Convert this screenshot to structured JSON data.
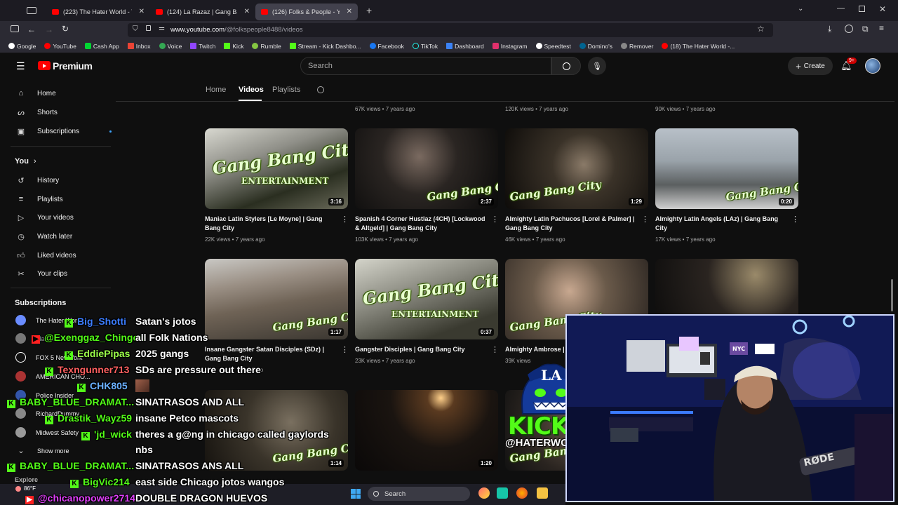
{
  "browser": {
    "tabs": [
      {
        "title": "(223) The Hater World - YouTube"
      },
      {
        "title": "(124) La Razaz | Gang Bang City"
      },
      {
        "title": "(126) Folks & People - YouTube"
      }
    ],
    "new_tab": "+",
    "url_domain": "www.youtube.com",
    "url_path": "/@folkspeople8488/videos",
    "bookmarks": [
      "Google",
      "YouTube",
      "Cash App",
      "Inbox",
      "Voice",
      "Twitch",
      "Kick",
      "Rumble",
      "Stream - Kick Dashbo...",
      "Facebook",
      "TikTok",
      "Dashboard",
      "Instagram",
      "Speedtest",
      "Domino's",
      "Remover",
      "(18) The Hater World -..."
    ]
  },
  "yt": {
    "logo": "Premium",
    "search_placeholder": "Search",
    "create": "Create",
    "notif_badge": "9+"
  },
  "sidebar": {
    "main": [
      "Home",
      "Shorts",
      "Subscriptions"
    ],
    "you_heading": "You",
    "you_items": [
      "History",
      "Playlists",
      "Your videos",
      "Watch later",
      "Liked videos",
      "Your clips"
    ],
    "subs_heading": "Subscriptions",
    "subs": [
      "The Hater World",
      "Marcus DeVante",
      "FOX 5 New York",
      "AMERICAN CHO...",
      "Police Insider",
      "RichardDummy",
      "Midwest Safety"
    ],
    "show_more": "Show more",
    "explore": "Explore"
  },
  "channel_tabs": [
    "Home",
    "Videos",
    "Playlists"
  ],
  "top_row_meta": [
    "67K views • 7 years ago",
    "120K views • 7 years ago",
    "90K views • 7 years ago"
  ],
  "videos_row1": [
    {
      "title": "Maniac Latin Stylers [Le Moyne] | Gang Bang City",
      "meta": "22K views • 7 years ago",
      "duration": "3:16"
    },
    {
      "title": "Spanish 4 Corner Hustlaz (4CH) [Lockwood & Altgeld] | Gang Bang City",
      "meta": "103K views • 7 years ago",
      "duration": "2:37"
    },
    {
      "title": "Almighty Latin Pachucos [Lorel & Palmer] | Gang Bang City",
      "meta": "46K views • 7 years ago",
      "duration": "1:29"
    },
    {
      "title": "Almighty Latin Angels (LAz) | Gang Bang City",
      "meta": "17K views • 7 years ago",
      "duration": "0:20"
    }
  ],
  "videos_row2": [
    {
      "title": "Insane Gangster Satan Disciples (SDz) | Gang Bang City",
      "meta": "...ago",
      "duration": "1:17"
    },
    {
      "title": "Gangster Disciples | Gang Bang City",
      "meta": "23K views • 7 years ago",
      "duration": "0:37"
    },
    {
      "title": "Almighty Ambrose |",
      "meta": "39K views",
      "duration": ""
    }
  ],
  "videos_row3": [
    {
      "duration": "1:14"
    },
    {
      "duration": "1:20"
    }
  ],
  "gbc_logo": {
    "line1": "Gang Bang City",
    "line2": "ENTERTAINMENT"
  },
  "chat": [
    {
      "user": "Big_Shotti",
      "msg": "Satan's jotos",
      "color": "#3c7dff"
    },
    {
      "user": "@Exenggaz_Chingon",
      "msg": "all Folk Nations",
      "color": "#53fc18"
    },
    {
      "user": "EddiePipas",
      "msg": "2025 gangs",
      "color": "#9cff4a"
    },
    {
      "user": "Texngunner713",
      "msg": "SDs are pressure out there",
      "color": "#ff6060"
    },
    {
      "user": "CHK805",
      "msg": "",
      "color": "#6ab0ff"
    },
    {
      "user": "BABY_BLUE_DRAMAT...",
      "msg": "SINATRASOS AND ALL",
      "color": "#53fc18"
    },
    {
      "user": "Drastik_Wayz59",
      "msg": "insane Petco mascots",
      "color": "#53fc18"
    },
    {
      "user": "'jd_wick",
      "msg": "theres a g@ng in chicago called gaylords",
      "color": "#53fc18"
    },
    {
      "user": "",
      "msg": "nbs",
      "color": "#fff"
    },
    {
      "user": "BABY_BLUE_DRAMAT...",
      "msg": "SINATRASOS ANS ALL",
      "color": "#53fc18"
    },
    {
      "user": "BigVic214",
      "msg": "east side Chicago jotos wangos",
      "color": "#53fc18"
    },
    {
      "user": "@chicanopower2714",
      "msg": "DOUBLE DRAGON HUEVOS",
      "color": "#e040fb"
    }
  ],
  "kick": {
    "brand": "KICK",
    "handle": "@HATERWORLD"
  },
  "taskbar": {
    "weather": "86°F",
    "search": "Search"
  },
  "colors": {
    "yt_red": "#ff0000",
    "kick_green": "#53fc18",
    "bg": "#0f0f0f"
  }
}
